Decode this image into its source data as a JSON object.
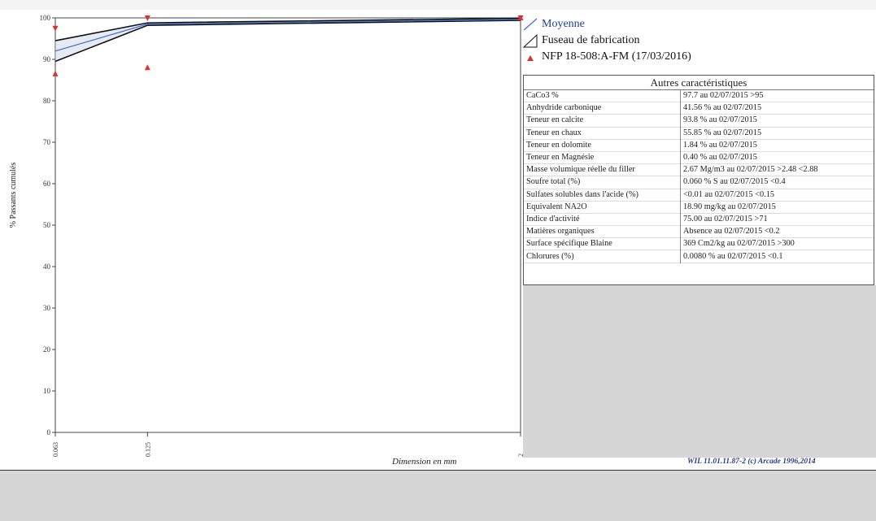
{
  "chart_data": {
    "type": "line",
    "title": "",
    "xlabel": "Dimension en mm",
    "ylabel": "% Passants cumulés",
    "x_scale": "log",
    "x_ticks": [
      "0.063",
      "0.125",
      "2"
    ],
    "x_tick_values": [
      0.063,
      0.125,
      2
    ],
    "y_ticks": [
      0,
      10,
      20,
      30,
      40,
      50,
      60,
      70,
      80,
      90,
      100
    ],
    "xlim": [
      0.063,
      2
    ],
    "ylim": [
      0,
      100
    ],
    "grid": true,
    "legend_position": "right",
    "series": [
      {
        "name": "Moyenne",
        "style": "line",
        "color": "#3b6fd8",
        "points": [
          [
            0.063,
            92
          ],
          [
            0.125,
            98.5
          ],
          [
            2,
            99.6
          ]
        ]
      },
      {
        "name": "Fuseau de fabrication",
        "style": "band",
        "color": "#111111",
        "upper": [
          [
            0.063,
            94.5
          ],
          [
            0.125,
            98.8
          ],
          [
            2,
            99.9
          ]
        ],
        "lower": [
          [
            0.063,
            89.5
          ],
          [
            0.125,
            98.2
          ],
          [
            2,
            99.4
          ]
        ]
      },
      {
        "name": "NFP 18-508:A-FM (17/03/2016)",
        "style": "triangles",
        "color": "#e03030",
        "points_up": [
          [
            0.063,
            86.5
          ],
          [
            0.125,
            88
          ],
          [
            2,
            100
          ]
        ],
        "points_down": [
          [
            0.063,
            97.5
          ],
          [
            0.125,
            100
          ],
          [
            2,
            100
          ]
        ]
      }
    ]
  },
  "table": {
    "title": "Autres caractéristiques",
    "rows": [
      {
        "label": "CaCo3 %",
        "value": "97.7  au 02/07/2015 >95"
      },
      {
        "label": "Anhydride carbonique",
        "value": "41.56 % au 02/07/2015"
      },
      {
        "label": "Teneur en calcite",
        "value": "93.8 %  au 02/07/2015"
      },
      {
        "label": "Teneur en chaux",
        "value": "55.85 %  au 02/07/2015"
      },
      {
        "label": "Teneur en dolomite",
        "value": "1.84 %  au 02/07/2015"
      },
      {
        "label": "Teneur en Magnésie",
        "value": "0.40 %  au 02/07/2015"
      },
      {
        "label": "Masse volumique réelle du filler",
        "value": "2.67 Mg/m3  au 02/07/2015 >2.48 <2.88"
      },
      {
        "label": "Soufre total (%)",
        "value": "0.060 % S  au 02/07/2015 <0.4"
      },
      {
        "label": "Sulfates solubles dans l'acide (%)",
        "value": "<0.01  au 02/07/2015 <0.15"
      },
      {
        "label": "Equivalent NA2O",
        "value": "18.90 mg/kg  au 02/07/2015"
      },
      {
        "label": "Indice d'activité",
        "value": "75.00  au 02/07/2015 >71"
      },
      {
        "label": "Matières organiques",
        "value": "Absence  au 02/07/2015 <0.2"
      },
      {
        "label": "Surface spécifique Blaine",
        "value": "369 Cm2/kg  au 02/07/2015 >300"
      },
      {
        "label": "Chlorures (%)",
        "value": "0.0080 %  au 02/07/2015 <0.1"
      }
    ]
  },
  "footer": {
    "credit": "WIL 11.01.11.87-2 (c) Arcade 1996,2014"
  }
}
